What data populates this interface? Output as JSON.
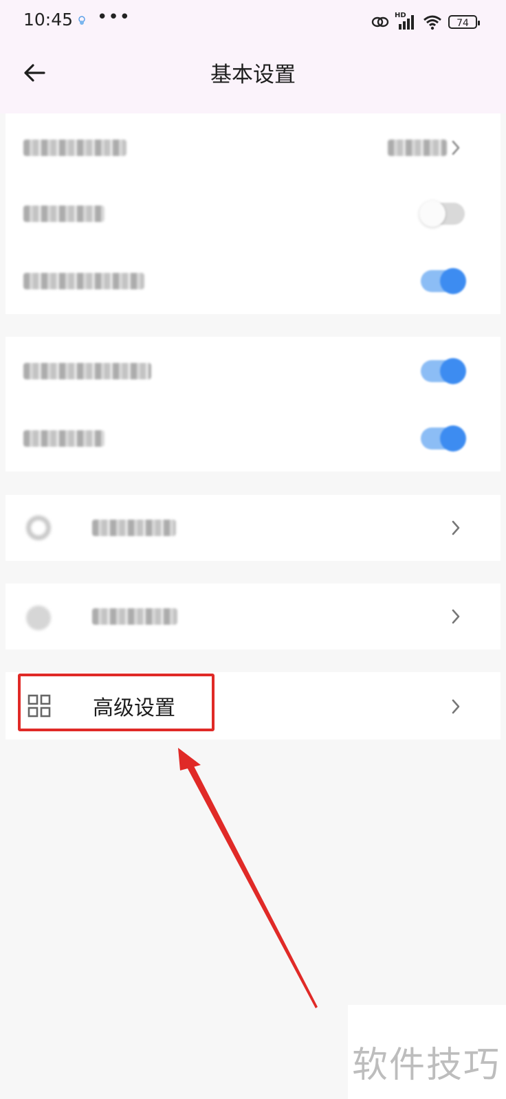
{
  "status_bar": {
    "time": "10:45",
    "dots": "•••",
    "network": "HD",
    "battery": "74"
  },
  "header": {
    "title": "基本设置"
  },
  "advanced_setting": {
    "label": "高级设置"
  },
  "watermark": {
    "text": "软件技巧"
  },
  "colors": {
    "accent_toggle": "#3d8cf1",
    "highlight_red": "#e02a27",
    "header_bg": "#fbf3fb",
    "page_bg": "#f7f7f7"
  },
  "toggles": {
    "row2": "off",
    "row3": "on",
    "row4": "on",
    "row5": "on"
  },
  "icons": [
    "back-arrow-icon",
    "grid-icon",
    "chevron-right-icon",
    "wifi-icon",
    "signal-icon",
    "battery-icon",
    "link-icon"
  ]
}
